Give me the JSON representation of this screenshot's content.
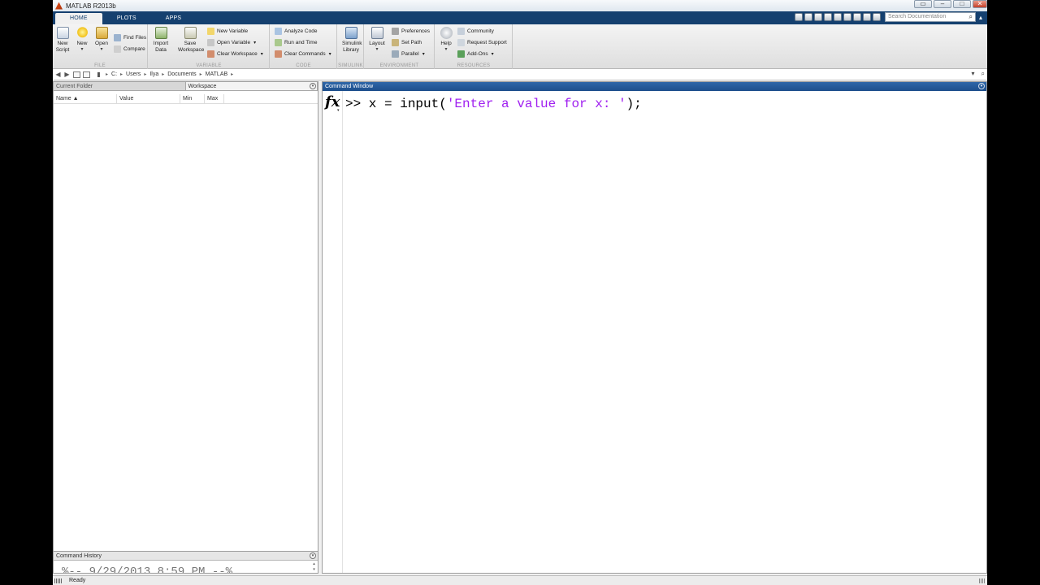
{
  "window": {
    "title": "MATLAB R2013b"
  },
  "tabs": [
    {
      "label": "HOME"
    },
    {
      "label": "PLOTS"
    },
    {
      "label": "APPS"
    }
  ],
  "search": {
    "placeholder": "Search Documentation"
  },
  "ribbon": {
    "file": {
      "label": "FILE",
      "new_script": "New Script",
      "new": "New",
      "open": "Open",
      "find_files": "Find Files",
      "compare": "Compare"
    },
    "variable": {
      "label": "VARIABLE",
      "import_data": "Import Data",
      "save_workspace": "Save Workspace",
      "new_variable": "New Variable",
      "open_variable": "Open Variable",
      "clear_workspace": "Clear Workspace"
    },
    "code": {
      "label": "CODE",
      "analyze_code": "Analyze Code",
      "run_and_time": "Run and Time",
      "clear_commands": "Clear Commands"
    },
    "simulink": {
      "label": "SIMULINK",
      "library": "Simulink Library"
    },
    "environment": {
      "label": "ENVIRONMENT",
      "layout": "Layout",
      "preferences": "Preferences",
      "set_path": "Set Path",
      "parallel": "Parallel"
    },
    "resources": {
      "label": "RESOURCES",
      "help": "Help",
      "community": "Community",
      "request_support": "Request Support",
      "add_ons": "Add-Ons"
    }
  },
  "path": [
    "C:",
    "Users",
    "Ilya",
    "Documents",
    "MATLAB"
  ],
  "left_panel": {
    "tabs": [
      "Current Folder",
      "Workspace"
    ],
    "columns": [
      "Name ▲",
      "Value",
      "Min",
      "Max"
    ]
  },
  "history": {
    "title": "Command History",
    "entry": "%-- 9/29/2013 8:59 PM --%"
  },
  "command_window": {
    "title": "Command Window",
    "prompt": ">>",
    "code": " x = input(",
    "string": "'Enter a value for x: '",
    "suffix": ");"
  },
  "status": {
    "text": "Ready"
  }
}
